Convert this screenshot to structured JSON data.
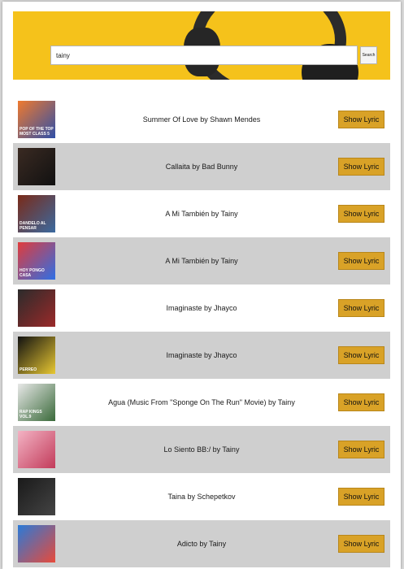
{
  "search": {
    "value": "tainy",
    "button_label": "Search"
  },
  "lyric_button_label": "Show Lyric",
  "results": [
    {
      "title": "Summer Of Love by Shawn Mendes",
      "cover_text": "POP OF THE TOP MOST CLASS 5",
      "cover_colors": [
        "#f07a2e",
        "#2f4fa8"
      ]
    },
    {
      "title": "Callaita by Bad Bunny",
      "cover_text": "",
      "cover_colors": [
        "#3a2a22",
        "#111111"
      ]
    },
    {
      "title": "A Mi También by Tainy",
      "cover_text": "Dandelo al Pensar",
      "cover_colors": [
        "#7a2a18",
        "#3b6aa0"
      ]
    },
    {
      "title": "A Mi También by Tainy",
      "cover_text": "HOY PONGO CASA",
      "cover_colors": [
        "#e13b3b",
        "#2e6fe6"
      ]
    },
    {
      "title": "Imaginaste by Jhayco",
      "cover_text": "",
      "cover_colors": [
        "#2b2b2b",
        "#9b2a2a"
      ]
    },
    {
      "title": "Imaginaste by Jhayco",
      "cover_text": "PERREO",
      "cover_colors": [
        "#111111",
        "#e8c832"
      ]
    },
    {
      "title": "Agua (Music From \"Sponge On The Run\" Movie) by Tainy",
      "cover_text": "RAP KINGS VOL.9",
      "cover_colors": [
        "#e8e8e8",
        "#3a6a3a"
      ]
    },
    {
      "title": "Lo Siento BB:/ by Tainy",
      "cover_text": "",
      "cover_colors": [
        "#f3b3c4",
        "#c23b5a"
      ]
    },
    {
      "title": "Taina by Schepetkov",
      "cover_text": "",
      "cover_colors": [
        "#1a1a1a",
        "#444444"
      ]
    },
    {
      "title": "Adicto by Tainy",
      "cover_text": "",
      "cover_colors": [
        "#2a7ad8",
        "#e84a3a"
      ]
    }
  ],
  "colors": {
    "hero_bg": "#f5c21b",
    "lyric_button_bg": "#d9a227",
    "alt_row_bg": "#cfcfcf"
  }
}
